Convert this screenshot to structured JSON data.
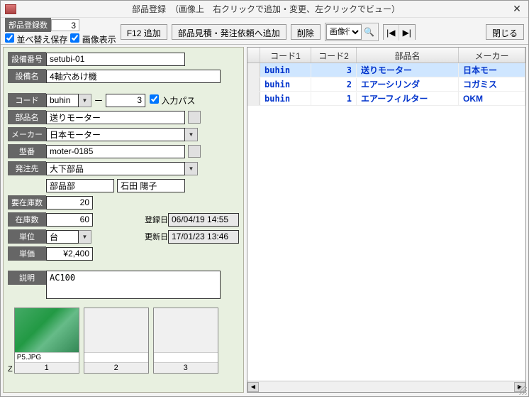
{
  "window": {
    "title": "部品登録　（画像上　右クリックで追加・変更、左クリックでビュー）"
  },
  "toolbar": {
    "reg_count_label": "部品登録数",
    "reg_count_value": "3",
    "sort_save_label": "並べ替え保存",
    "img_disp_label": "画像表示",
    "f12_add": "F12 追加",
    "estimate_add": "部品見積・発注依頼へ追加",
    "delete": "削除",
    "img_combo": "画像行",
    "close": "閉じる"
  },
  "form": {
    "setsubi_no_label": "設備番号",
    "setsubi_no": "setubi-01",
    "setsubi_name_label": "設備名",
    "setsubi_name": "4軸穴あけ機",
    "code_label": "コード",
    "code": "buhin",
    "code2": "3",
    "input_path_label": "入力パス",
    "part_name_label": "部品名",
    "part_name": "送りモーター",
    "maker_label": "メーカー",
    "maker": "日本モーター",
    "model_label": "型番",
    "model": "moter-0185",
    "order_to_label": "発注先",
    "order_to": "大下部品",
    "dept": "部品部",
    "person": "石田 陽子",
    "req_stock_label": "要在庫数",
    "req_stock": "20",
    "stock_label": "在庫数",
    "stock": "60",
    "reg_date_label": "登録日",
    "reg_date": "06/04/19 14:55",
    "unit_label": "単位",
    "unit": "台",
    "upd_date_label": "更新日",
    "upd_date": "17/01/23 13:46",
    "price_label": "単価",
    "price": "¥2,400",
    "desc_label": "説明",
    "desc": "AC100"
  },
  "thumbs": {
    "zlabel": "Z",
    "items": [
      {
        "caption": "P5.JPG",
        "num": "1",
        "has_image": true
      },
      {
        "caption": "",
        "num": "2",
        "has_image": false
      },
      {
        "caption": "",
        "num": "3",
        "has_image": false
      }
    ]
  },
  "grid": {
    "headers": {
      "rowsel": "",
      "code1": "コード1",
      "code2": "コード2",
      "name": "部品名",
      "maker": "メーカー"
    },
    "rows": [
      {
        "code1": "buhin",
        "code2": "3",
        "name": "送りモーター",
        "maker": "日本モー",
        "sel": true
      },
      {
        "code1": "buhin",
        "code2": "2",
        "name": "エアーシリンダ",
        "maker": "コガミス",
        "sel": false
      },
      {
        "code1": "buhin",
        "code2": "1",
        "name": "エアーフィルター",
        "maker": "OKM",
        "sel": false
      }
    ]
  }
}
